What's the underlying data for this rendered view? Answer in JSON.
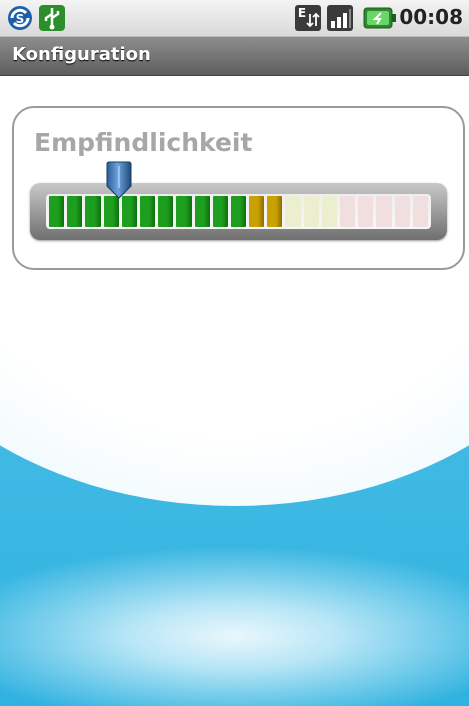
{
  "status_bar": {
    "time": "00:08",
    "icons": [
      "sync-app-icon",
      "usb-icon",
      "edge-data-icon",
      "signal-icon",
      "battery-icon"
    ]
  },
  "header": {
    "title": "Konfiguration"
  },
  "sensitivity": {
    "label": "Empfindlichkeit",
    "segments_total": 21,
    "active_green": 11,
    "active_yellow": 2,
    "thumb_position_fraction": 0.19,
    "colors": {
      "green_on": "#1e9e1e",
      "yellow_on": "#c9a100",
      "yellow_off": "#eceed0",
      "red_off": "#f1dede"
    }
  }
}
